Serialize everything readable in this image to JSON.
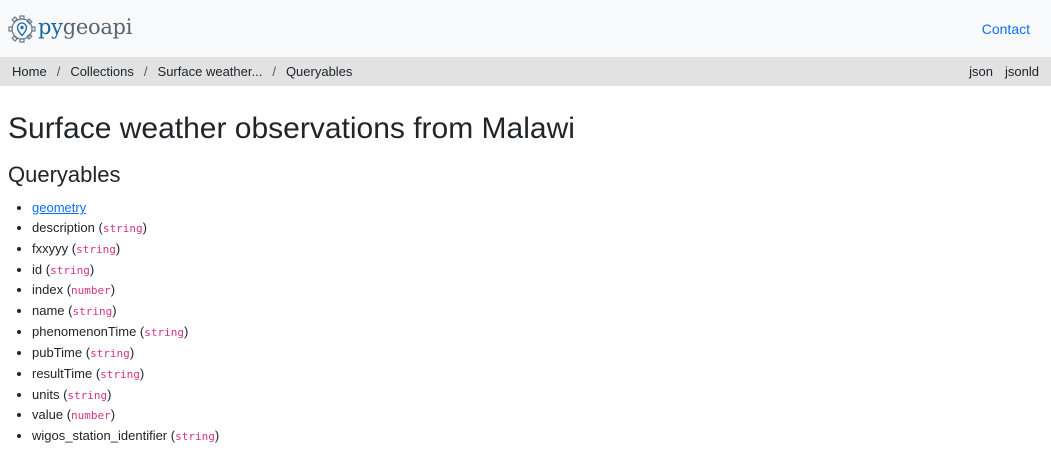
{
  "brand": {
    "part1": "py",
    "part2": "geoapi"
  },
  "nav": {
    "contact": "Contact"
  },
  "breadcrumb": {
    "items": [
      "Home",
      "Collections",
      "Surface weather...",
      "Queryables"
    ],
    "separator": "/"
  },
  "formats": {
    "json": "json",
    "jsonld": "jsonld"
  },
  "page": {
    "title": "Surface weather observations from Malawi",
    "subtitle": "Queryables"
  },
  "queryables": [
    {
      "name": "geometry",
      "type": null,
      "link": true
    },
    {
      "name": "description",
      "type": "string"
    },
    {
      "name": "fxxyyy",
      "type": "string"
    },
    {
      "name": "id",
      "type": "string"
    },
    {
      "name": "index",
      "type": "number"
    },
    {
      "name": "name",
      "type": "string"
    },
    {
      "name": "phenomenonTime",
      "type": "string"
    },
    {
      "name": "pubTime",
      "type": "string"
    },
    {
      "name": "resultTime",
      "type": "string"
    },
    {
      "name": "units",
      "type": "string"
    },
    {
      "name": "value",
      "type": "number"
    },
    {
      "name": "wigos_station_identifier",
      "type": "string"
    }
  ],
  "colors": {
    "link": "#0d6efd",
    "type_code": "#d63384",
    "navbar_bg": "#f8f9fa",
    "breadcrumb_bg": "#e2e2e2",
    "logo_blue": "#1565a9"
  }
}
